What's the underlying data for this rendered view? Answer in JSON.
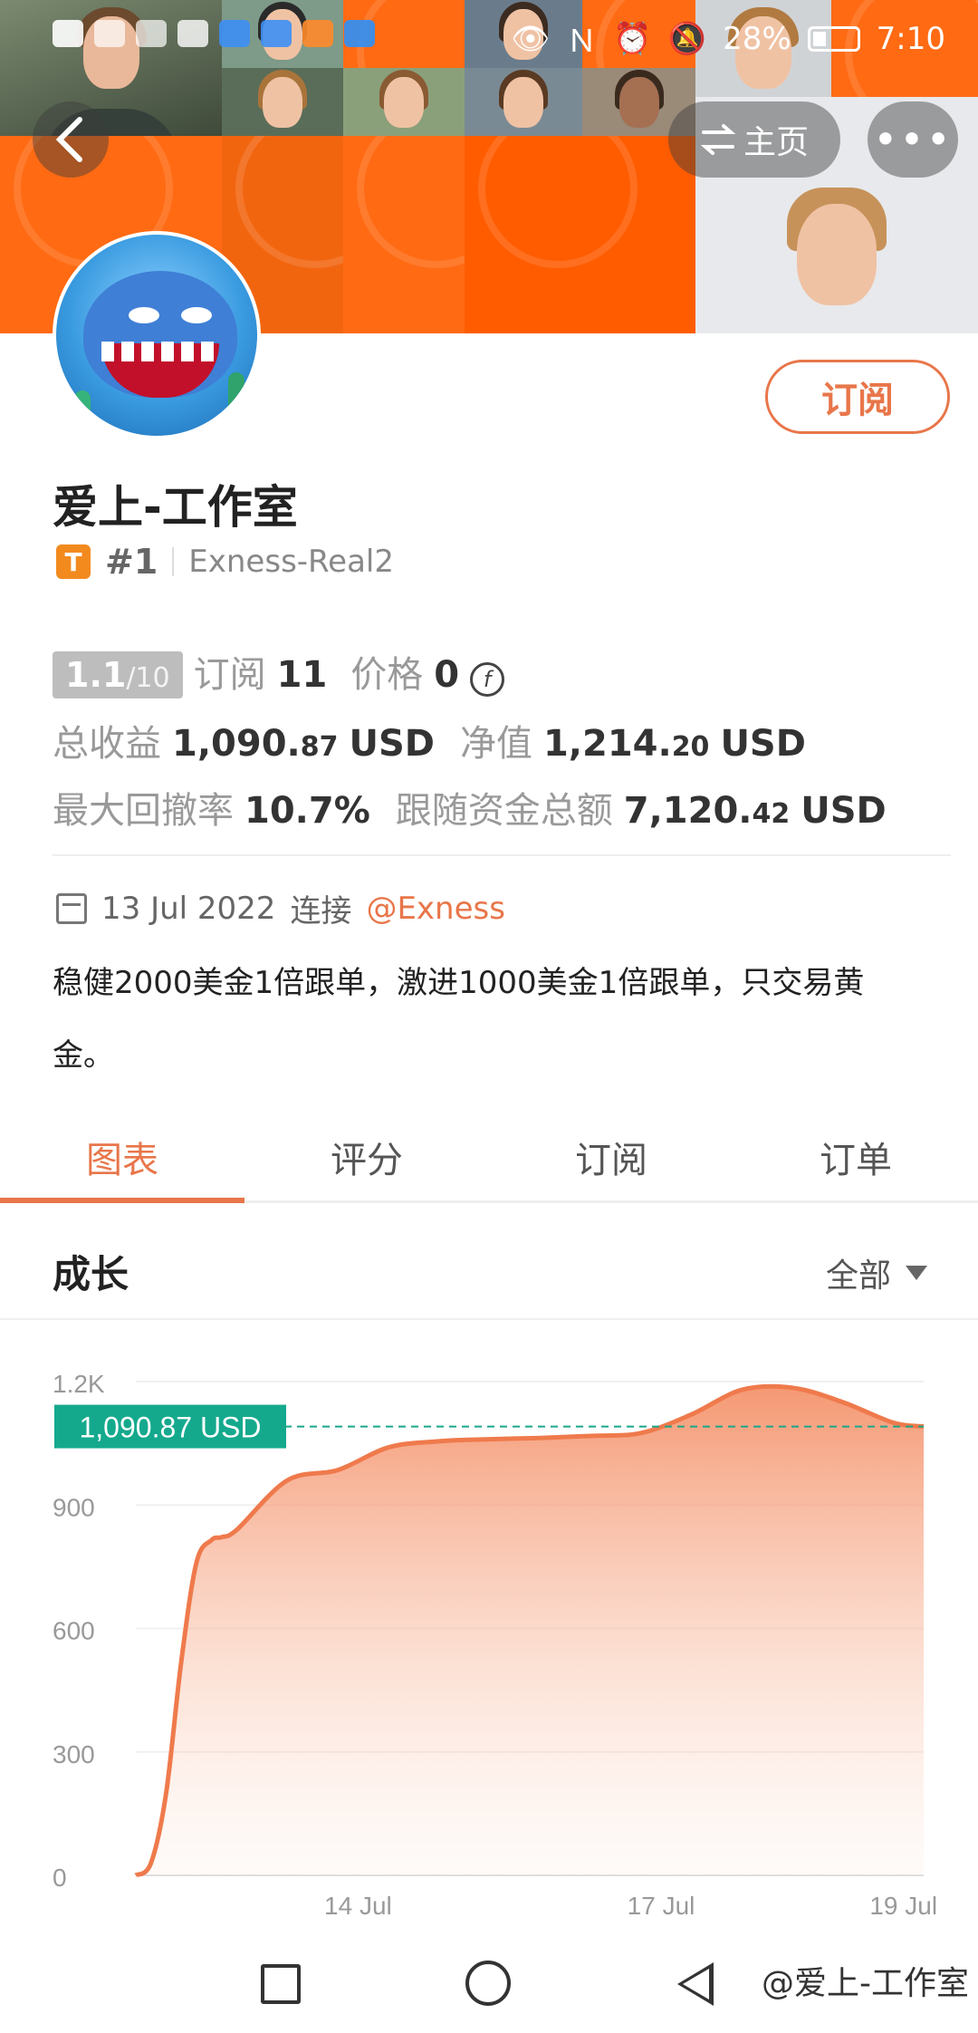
{
  "status_bar": {
    "battery": "28%",
    "time": "7:10"
  },
  "header": {
    "home_label": "主页",
    "more_label": "•••"
  },
  "profile": {
    "subscribe_label": "订阅",
    "name": "爱上-工作室",
    "badge_letter": "T",
    "rank": "#1",
    "server": "Exness-Real2"
  },
  "stats": {
    "score": "1.1",
    "score_max": "/10",
    "subscriptions_label": "订阅",
    "subscriptions": "11",
    "price_label": "价格",
    "price": "0",
    "total_profit_label": "总收益",
    "total_profit_int": "1,090.",
    "total_profit_dec": "87",
    "total_profit_unit": "USD",
    "equity_label": "净值",
    "equity_int": "1,214.",
    "equity_dec": "20",
    "equity_unit": "USD",
    "max_drawdown_label": "最大回撤率",
    "max_drawdown": "10.7%",
    "follow_funds_label": "跟随资金总额",
    "follow_funds_int": "7,120.",
    "follow_funds_dec": "42",
    "follow_funds_unit": "USD"
  },
  "connection": {
    "date": "13 Jul 2022",
    "connect_label": "连接",
    "broker": "@Exness"
  },
  "description": "稳健2000美金1倍跟单，激进1000美金1倍跟单，只交易黄金。",
  "tabs": [
    "图表",
    "评分",
    "订阅",
    "订单"
  ],
  "section": {
    "title": "成长",
    "filter": "全部"
  },
  "chart_data": {
    "type": "area",
    "title": "成长",
    "y_ticks": [
      "1.2K",
      "900",
      "600",
      "300",
      "0"
    ],
    "x_ticks": [
      "14 Jul",
      "17 Jul",
      "19 Jul"
    ],
    "ylim": [
      0,
      1200
    ],
    "current_value_label": "1,090.87 USD",
    "current_value": 1090.87,
    "series": [
      {
        "x": [
          0,
          0.15,
          0.3,
          0.45,
          0.6,
          0.75,
          0.85,
          1.0,
          1.5,
          2.0,
          2.5,
          3.0,
          3.5,
          4.0,
          4.5,
          5.0,
          5.5,
          6.0,
          6.5,
          7.0,
          7.5,
          7.8
        ],
        "y": [
          0,
          30,
          200,
          520,
          760,
          815,
          822,
          840,
          960,
          985,
          1040,
          1055,
          1060,
          1063,
          1068,
          1075,
          1120,
          1180,
          1185,
          1150,
          1100,
          1091
        ]
      }
    ]
  },
  "watermark": "@爱上-工作室"
}
